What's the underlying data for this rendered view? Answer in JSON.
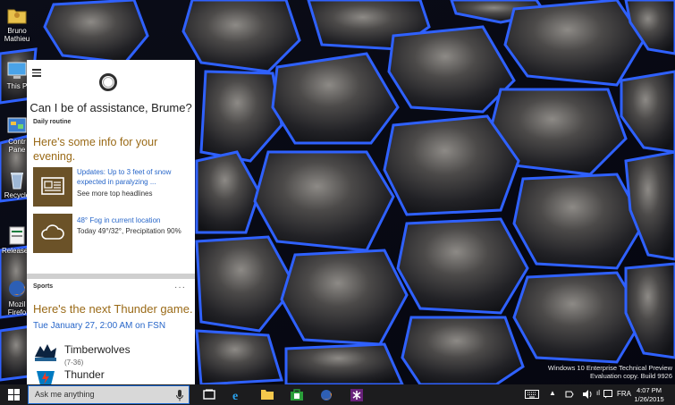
{
  "desktop": {
    "icons": [
      {
        "label": "Bruno\nMathieu",
        "icon": "user-folder-icon"
      },
      {
        "label": "This P",
        "icon": "this-pc-icon"
      },
      {
        "label": "Contr\nPane",
        "icon": "control-panel-icon"
      },
      {
        "label": "Recycle",
        "icon": "recycle-bin-icon"
      },
      {
        "label": "ReleaseN",
        "icon": "release-notes-icon"
      },
      {
        "label": "Mozil\nFirefo",
        "icon": "firefox-icon"
      }
    ]
  },
  "cortana": {
    "greeting": "Can I be of assistance, Brume?",
    "section_daily": "Daily routine",
    "intro": "Here's some info for your evening.",
    "news_card": {
      "title": "Updates: Up to 3 feet of snow expected in paralyzing ...",
      "subtitle": "See more top headlines",
      "icon": "newspaper-icon"
    },
    "weather_card": {
      "title": "48° Fog in current location",
      "subtitle": "Today 49°/32°, Precipitation 90%",
      "icon": "cloud-icon"
    },
    "section_sports": "Sports",
    "more": "···",
    "sports_title": "Here's the next Thunder game.",
    "game_time": "Tue January 27, 2:00 AM on FSN",
    "teams": [
      {
        "name": "Timberwolves",
        "record": "(7-36)"
      },
      {
        "name": "Thunder",
        "record": ""
      }
    ]
  },
  "watermark": {
    "line1": "Windows 10 Enterprise Technical Preview",
    "line2": "Evaluation copy. Build 9926"
  },
  "taskbar": {
    "search_placeholder": "Ask me anything",
    "apps": [
      "task-view-icon",
      "internet-explorer-icon",
      "file-explorer-icon",
      "store-icon",
      "firefox-icon",
      "visual-studio-icon"
    ],
    "language": "FRA",
    "time": "4:07 PM",
    "date": "1/26/2015"
  },
  "colors": {
    "accent": "#2766c9",
    "heading": "#9a6a17",
    "tile": "#6b5228",
    "taskbar": "#1c1c1e"
  }
}
